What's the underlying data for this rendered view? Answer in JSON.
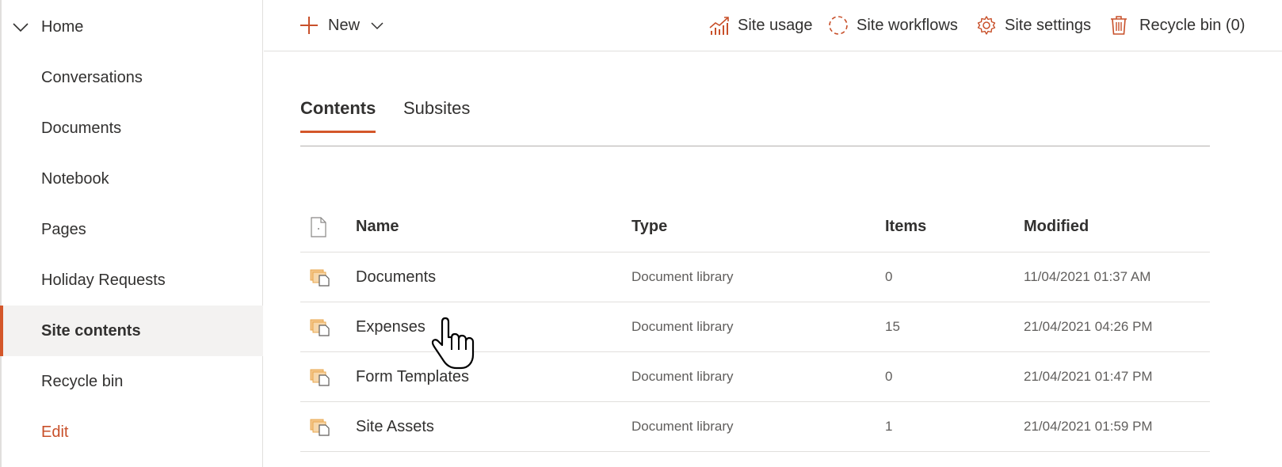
{
  "sidebar": {
    "home": {
      "label": "Home",
      "icon": "chevron-down-icon"
    },
    "items": [
      {
        "label": "Conversations",
        "active": false
      },
      {
        "label": "Documents",
        "active": false
      },
      {
        "label": "Notebook",
        "active": false
      },
      {
        "label": "Pages",
        "active": false
      },
      {
        "label": "Holiday Requests",
        "active": false
      },
      {
        "label": "Site contents",
        "active": true
      },
      {
        "label": "Recycle bin",
        "active": false
      }
    ],
    "edit_label": "Edit"
  },
  "commandbar": {
    "new_label": "New",
    "site_usage_label": "Site usage",
    "site_workflows_label": "Site workflows",
    "site_settings_label": "Site settings",
    "recycle_bin_label": "Recycle bin (0)"
  },
  "tabs": [
    {
      "label": "Contents",
      "active": true
    },
    {
      "label": "Subsites",
      "active": false
    }
  ],
  "table": {
    "columns": {
      "name": "Name",
      "type": "Type",
      "items": "Items",
      "modified": "Modified"
    },
    "rows": [
      {
        "name": "Documents",
        "type": "Document library",
        "items": "0",
        "modified": "11/04/2021 01:37 AM"
      },
      {
        "name": "Expenses",
        "type": "Document library",
        "items": "15",
        "modified": "21/04/2021 04:26 PM"
      },
      {
        "name": "Form Templates",
        "type": "Document library",
        "items": "0",
        "modified": "21/04/2021 01:47 PM"
      },
      {
        "name": "Site Assets",
        "type": "Document library",
        "items": "1",
        "modified": "21/04/2021 01:59 PM"
      }
    ]
  },
  "colors": {
    "accent": "#d4572a",
    "icon_orange": "#c8502a",
    "library_icon": "#e8a74e"
  }
}
